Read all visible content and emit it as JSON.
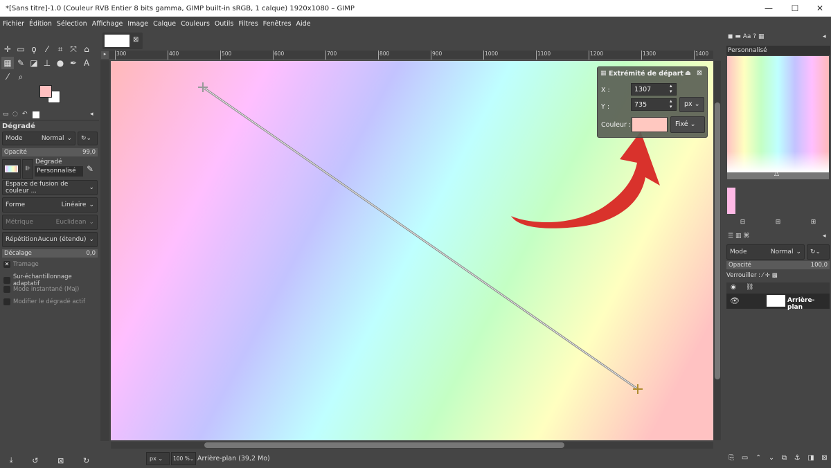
{
  "window": {
    "title": "*[Sans titre]-1.0 (Couleur RVB Entier 8 bits gamma, GIMP built-in sRGB, 1 calque) 1920x1080 – GIMP",
    "minimize": "—",
    "maximize": "☐",
    "close": "✕"
  },
  "menu": [
    "Fichier",
    "Édition",
    "Sélection",
    "Affichage",
    "Image",
    "Calque",
    "Couleurs",
    "Outils",
    "Filtres",
    "Fenêtres",
    "Aide"
  ],
  "tool_options": {
    "title": "Dégradé",
    "mode_label": "Mode",
    "mode_value": "Normal",
    "opacity_label": "Opacité",
    "opacity_value": "99,0",
    "gradient_label": "Dégradé",
    "gradient_name": "Personnalisé",
    "blend_space": "Espace de fusion de couleur ...",
    "shape_label": "Forme",
    "shape_value": "Linéaire",
    "metric_label": "Métrique",
    "metric_value": "Euclidean",
    "repeat_label": "Répétition",
    "repeat_value": "Aucun (étendu)",
    "offset_label": "Décalage",
    "offset_value": "0,0",
    "checkboxes": [
      {
        "label": "Tramage",
        "checked": true
      },
      {
        "label": "Sur-échantillonnage adaptatif",
        "checked": false
      },
      {
        "label": "Mode instantané (Maj)",
        "checked": false
      },
      {
        "label": "Modifier le dégradé actif",
        "checked": false
      }
    ]
  },
  "colors": {
    "foreground": "#ffc0c0",
    "background": "#ffffff",
    "accent_arrow": "#d9322c"
  },
  "ruler": {
    "labels": [
      "300",
      "400",
      "500",
      "600",
      "700",
      "800",
      "900",
      "1000",
      "1100",
      "1200",
      "1300",
      "1400"
    ]
  },
  "dialog": {
    "title": "Extrémité de départ",
    "x_label": "X :",
    "x_value": "1307",
    "y_label": "Y :",
    "y_value": "735",
    "unit": "px",
    "color_label": "Couleur :",
    "color_value": "#ffc8c0",
    "color_mode": "Fixé"
  },
  "gradient_panel": {
    "title": "Personnalisé"
  },
  "layers": {
    "mode_label": "Mode",
    "mode_value": "Normal",
    "opacity_label": "Opacité",
    "opacity_value": "100,0",
    "lock_label": "Verrouiller :",
    "items": [
      {
        "name": "Arrière-plan",
        "visible": true
      }
    ]
  },
  "statusbar": {
    "unit": "px",
    "zoom": "100 %",
    "info": "Arrière-plan (39,2 Mo)"
  }
}
